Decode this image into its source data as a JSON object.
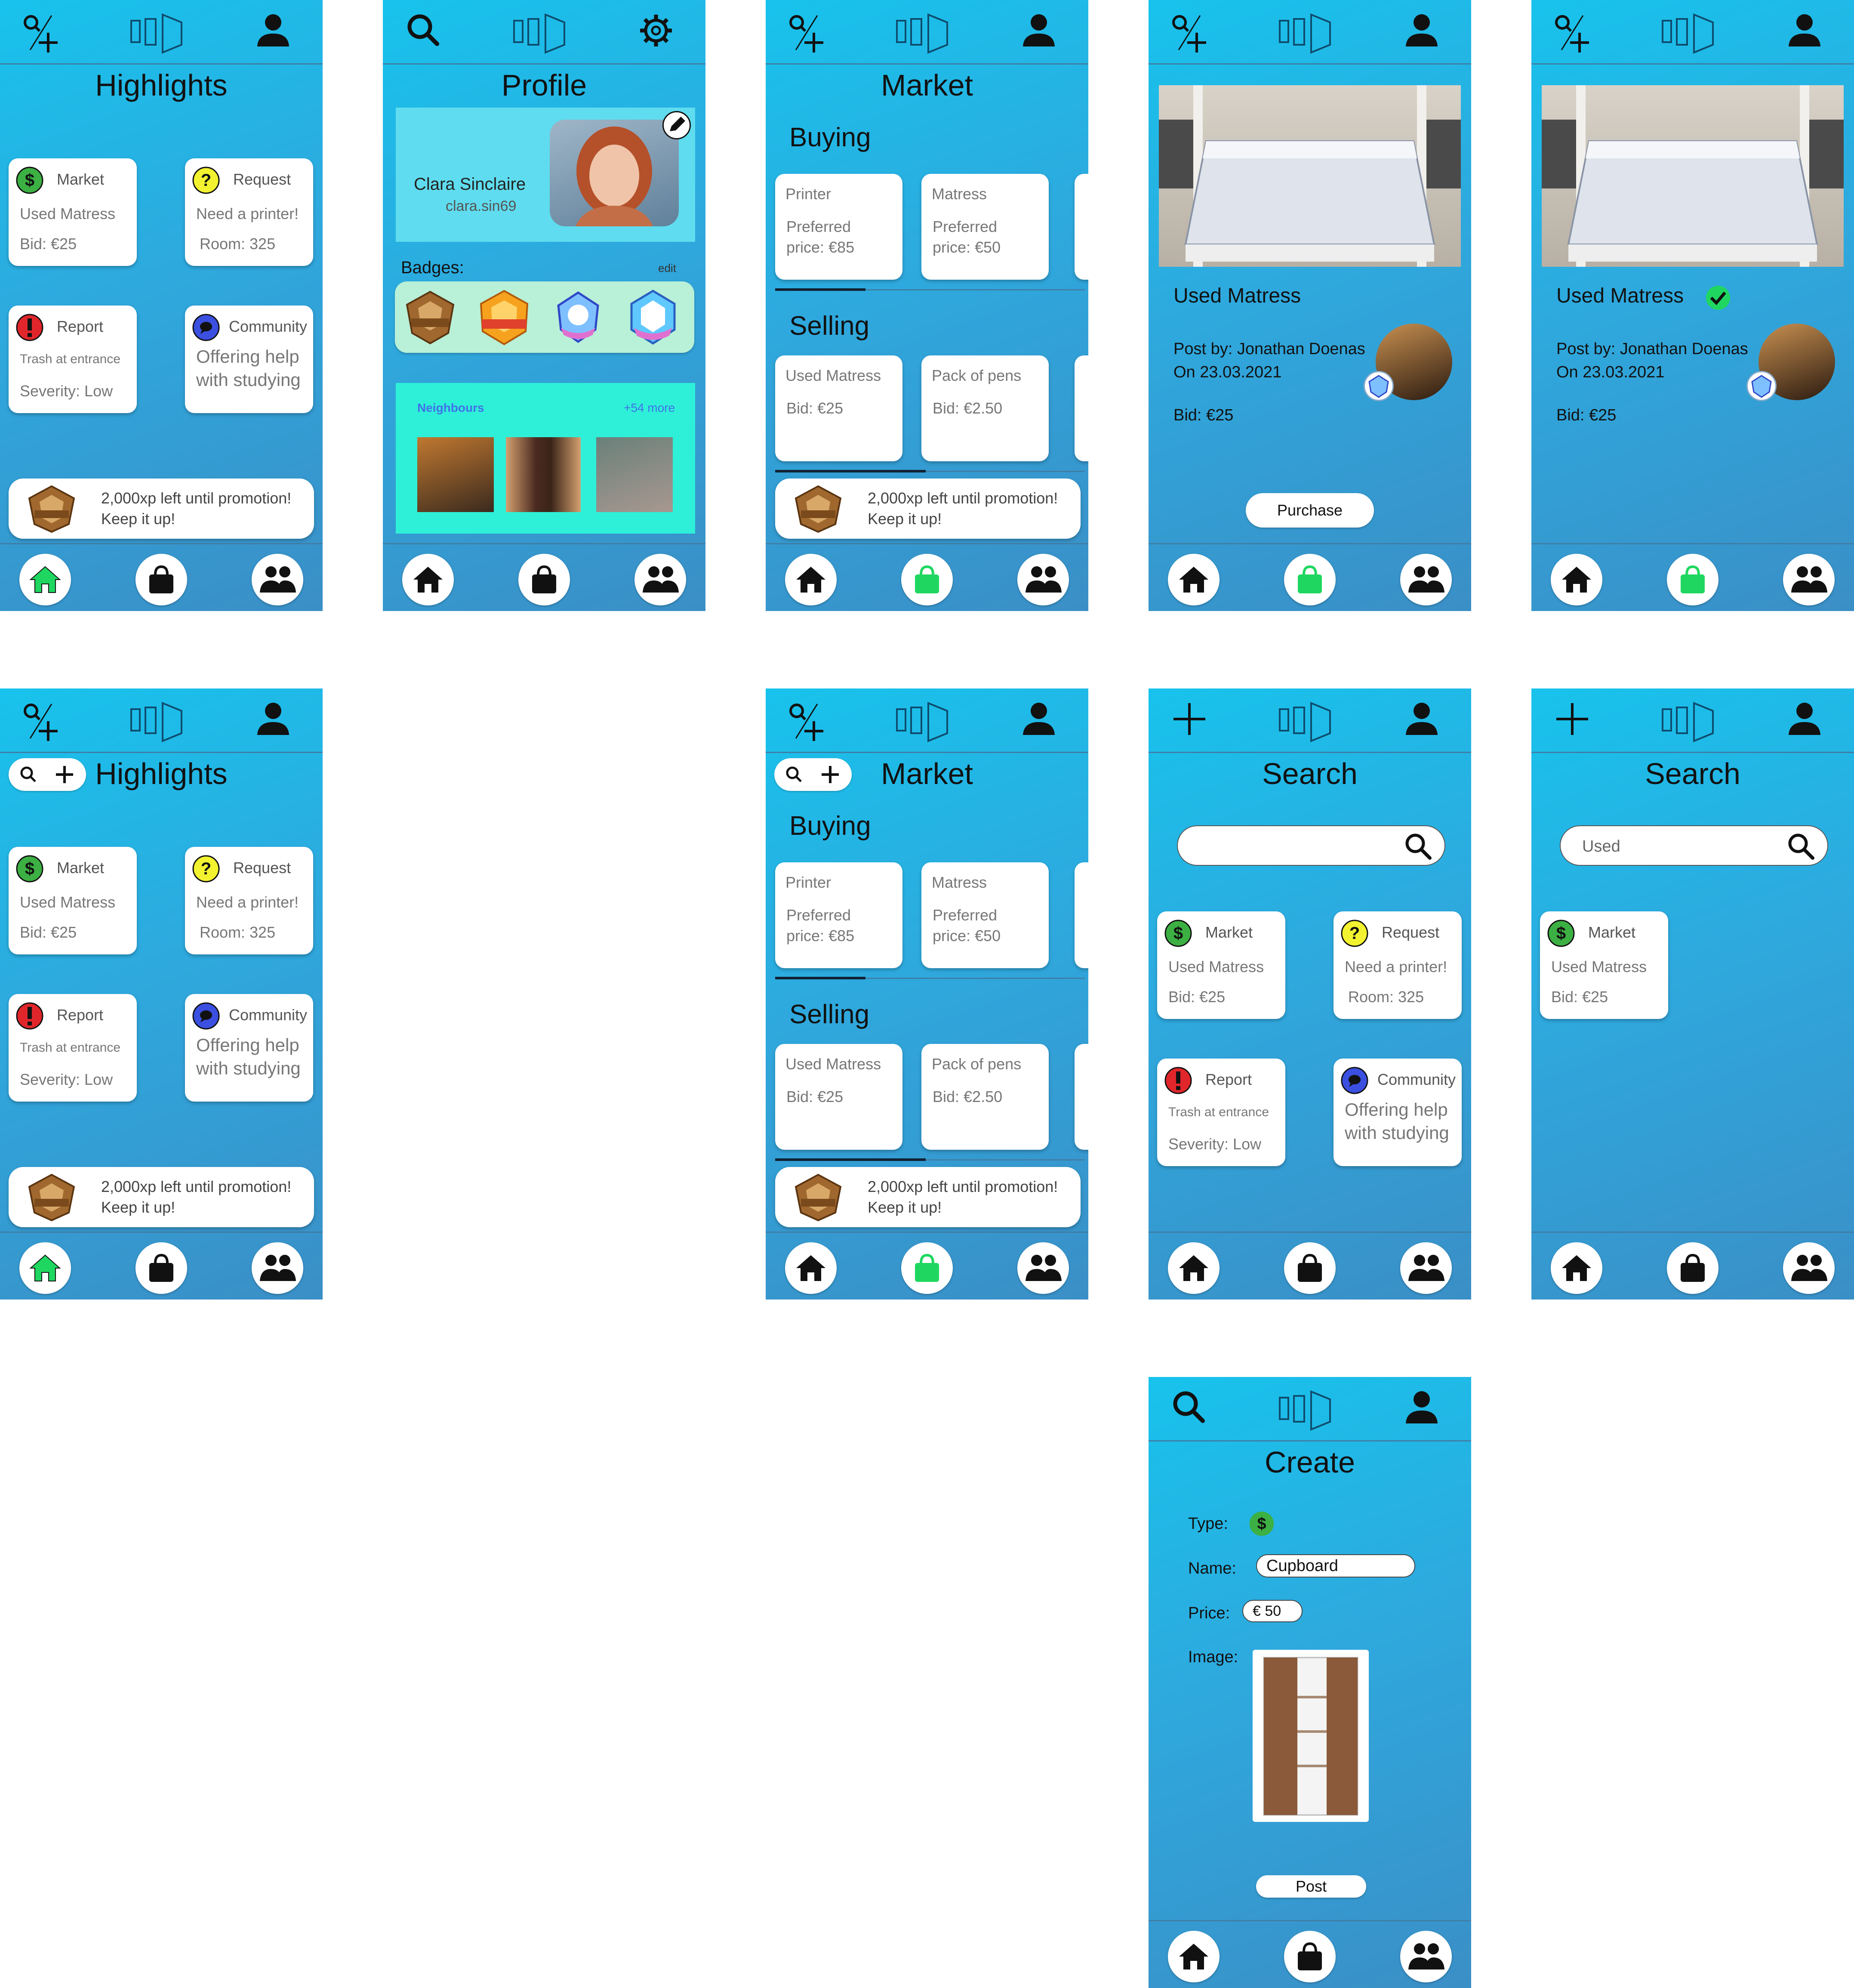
{
  "highlights": {
    "title": "Highlights",
    "cards": [
      {
        "type": "Market",
        "line1": "Used Matress",
        "line2": "Bid: €25"
      },
      {
        "type": "Request",
        "line1": "Need a printer!",
        "line2": "Room: 325"
      },
      {
        "type": "Report",
        "line1": "Trash at entrance",
        "line2": "Severity: Low"
      },
      {
        "type": "Community",
        "line1": "Offering help",
        "line2": "with studying"
      }
    ]
  },
  "promo": {
    "line1": "2,000xp left until promotion!",
    "line2": "Keep it up!"
  },
  "profile": {
    "title": "Profile",
    "name": "Clara Sinclaire",
    "handle": "clara.sin69",
    "badges_label": "Badges:",
    "edit_label": "edit",
    "neighbours_label": "Neighbours",
    "more_label": "+54 more"
  },
  "market": {
    "title": "Market",
    "buying_label": "Buying",
    "selling_label": "Selling",
    "buying": [
      {
        "name": "Printer",
        "line1": "Preferred",
        "line2": "price: €85"
      },
      {
        "name": "Matress",
        "line1": "Preferred",
        "line2": "price: €50"
      }
    ],
    "selling": [
      {
        "name": "Used Matress",
        "line1": "Bid: €25"
      },
      {
        "name": "Pack of pens",
        "line1": "Bid: €2.50"
      }
    ]
  },
  "item": {
    "title": "Used Matress",
    "post_by": "Post by: Jonathan Doenas",
    "date": "On 23.03.2021",
    "bid": "Bid: €25",
    "purchase_label": "Purchase"
  },
  "search": {
    "title": "Search",
    "query": "Used"
  },
  "create": {
    "title": "Create",
    "type_label": "Type:",
    "name_label": "Name:",
    "name_value": "Cupboard",
    "price_label": "Price:",
    "price_value": "€ 50",
    "image_label": "Image:",
    "post_label": "Post"
  },
  "colors": {
    "market": "#3cb043",
    "request": "#f2f230",
    "report": "#e0262b",
    "community": "#3b4fe0",
    "nav_active": "#1fd760"
  }
}
